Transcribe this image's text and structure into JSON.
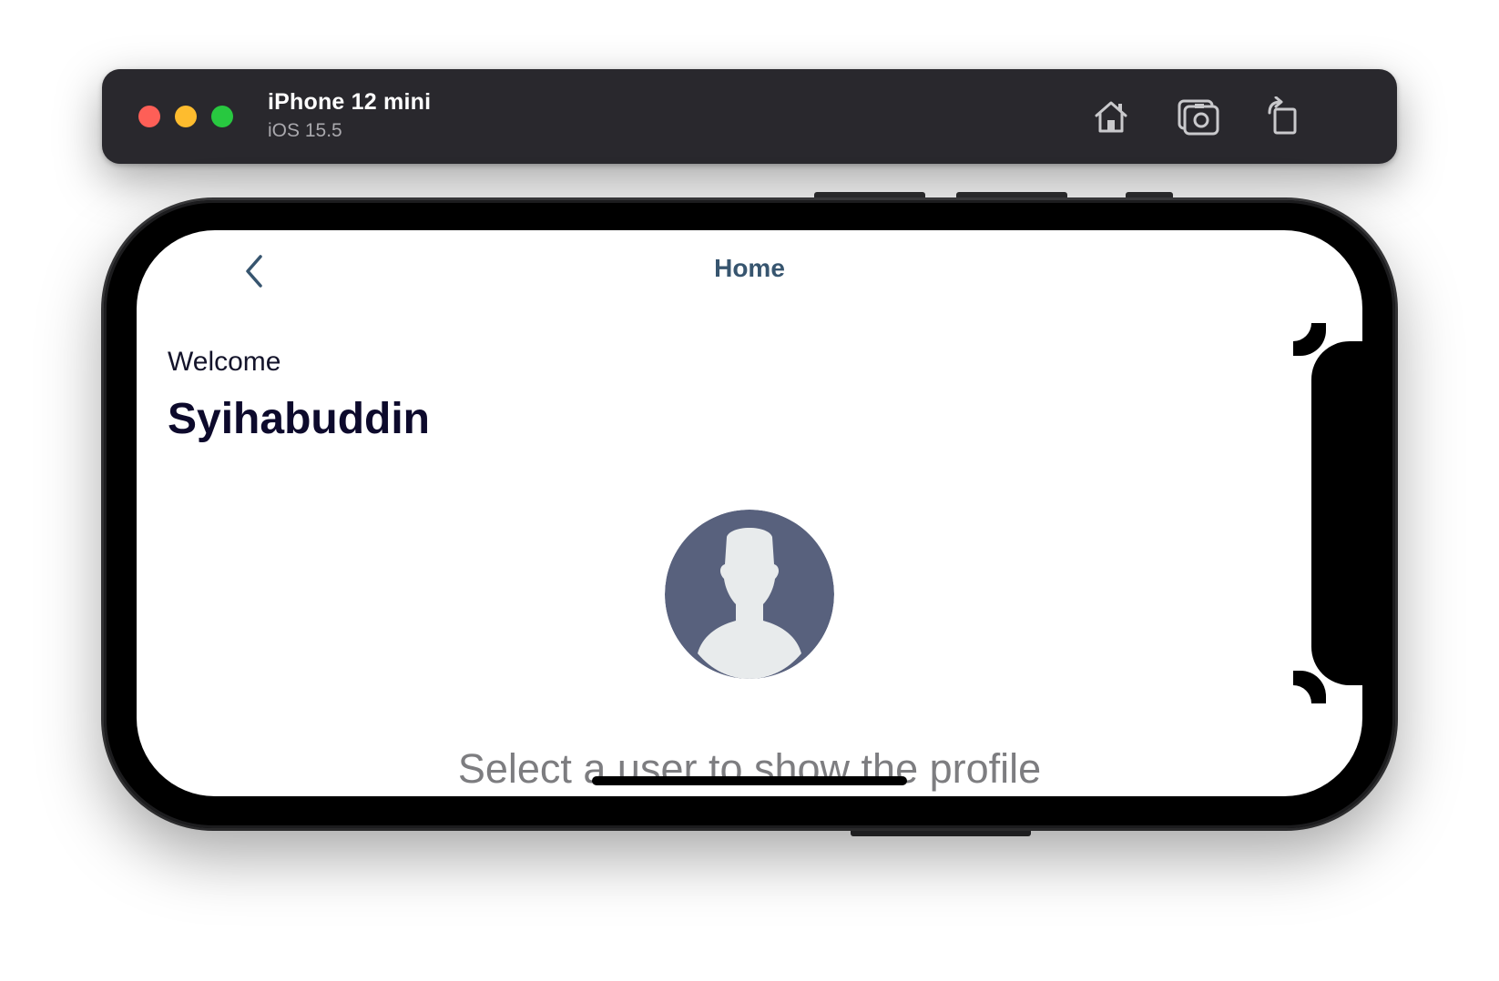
{
  "simulator": {
    "device_name": "iPhone 12 mini",
    "os_version": "iOS 15.5",
    "toolbar_icons": [
      "home-icon",
      "screenshot-icon",
      "rotate-icon"
    ],
    "colors": {
      "titlebar": "#29282d",
      "close": "#fe5f57",
      "minimize": "#febc2e",
      "zoom": "#28c840"
    }
  },
  "app": {
    "nav": {
      "title": "Home",
      "back_icon": "chevron-left-icon"
    },
    "greeting": "Welcome",
    "username": "Syihabuddin",
    "avatar_icon": "user-silhouette-icon",
    "hint": "Select a user to show the profile",
    "colors": {
      "nav_title": "#37556f",
      "username": "#0d0a2c",
      "hint": "#7d7d80",
      "avatar_bg": "#58617d",
      "avatar_figure": "#e8ebec"
    }
  }
}
